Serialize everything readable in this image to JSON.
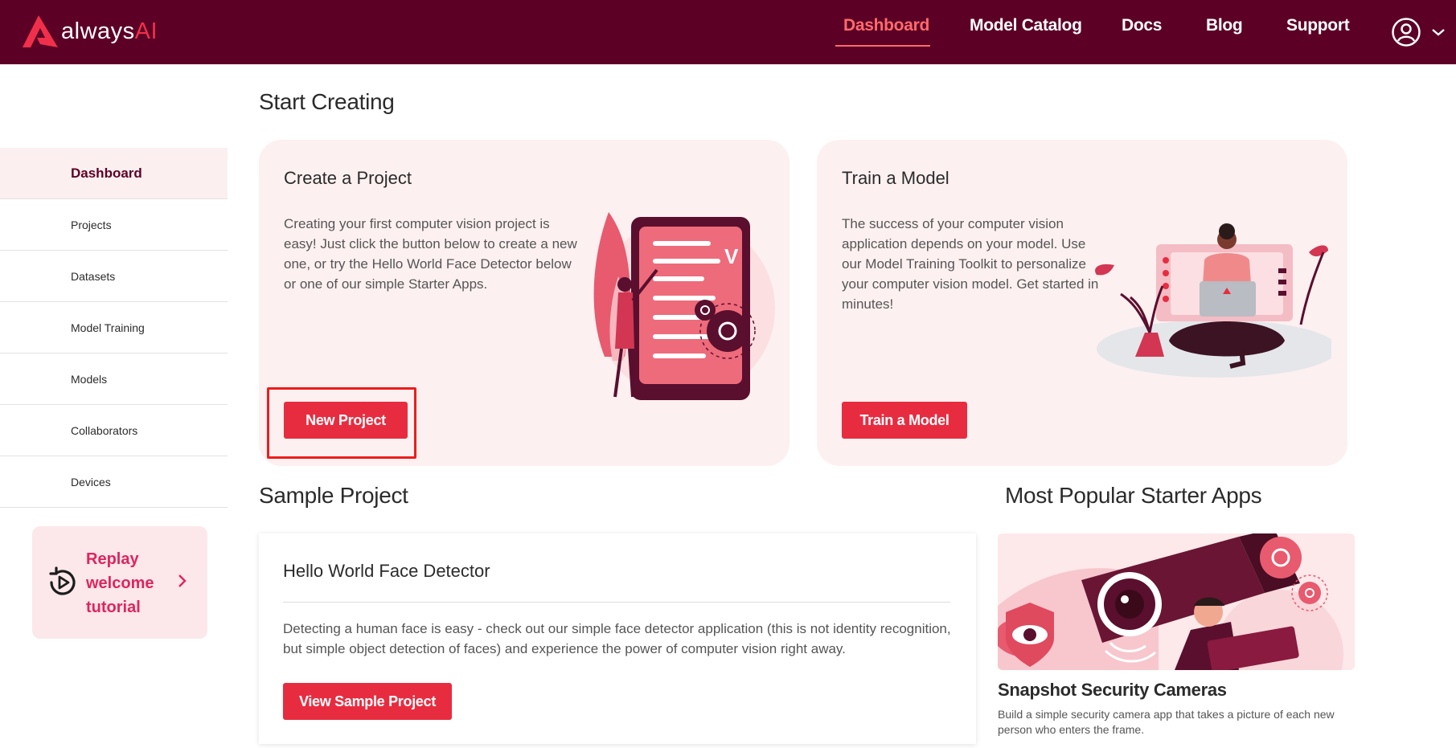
{
  "brand": {
    "name_prefix": "always",
    "name_suffix": "AI"
  },
  "nav": {
    "links": [
      "Dashboard",
      "Model Catalog",
      "Docs",
      "Blog",
      "Support"
    ],
    "active": "Dashboard",
    "account_icon": "user-circle-icon",
    "dropdown_icon": "chevron-down-icon"
  },
  "sidebar": {
    "items": [
      {
        "label": "Dashboard",
        "active": true
      },
      {
        "label": "Projects"
      },
      {
        "label": "Datasets"
      },
      {
        "label": "Model Training"
      },
      {
        "label": "Models"
      },
      {
        "label": "Collaborators"
      },
      {
        "label": "Devices"
      }
    ],
    "replay": {
      "line1": "Replay",
      "line2": "welcome",
      "line3": "tutorial"
    }
  },
  "start_creating": {
    "heading": "Start Creating",
    "create_project": {
      "title": "Create a Project",
      "text": "Creating your first computer vision project is easy! Just click the button below to create a new one, or try the Hello World Face Detector below or one of our simple Starter Apps.",
      "button": "New Project"
    },
    "train_model": {
      "title": "Train a Model",
      "text": "The success of your computer vision application depends on your model. Use our Model Training Toolkit to personalize your computer vision model. Get started in minutes!",
      "button": "Train a Model"
    }
  },
  "sample_project": {
    "heading": "Sample Project",
    "title": "Hello World Face Detector",
    "text": "Detecting a human face is easy - check out our simple face detector application (this is not identity recognition, but simple object detection of faces) and experience the power of computer vision right away.",
    "button": "View Sample Project"
  },
  "starter_apps": {
    "heading": "Most Popular Starter Apps",
    "app": {
      "title": "Snapshot Security Cameras",
      "description": "Build a simple security camera app that takes a picture of each new person who enters the frame."
    }
  },
  "colors": {
    "nav_bg": "#5c0026",
    "accent": "#e82c40",
    "active_link": "#ff6b6b",
    "card_bg": "#fdf0f0"
  }
}
